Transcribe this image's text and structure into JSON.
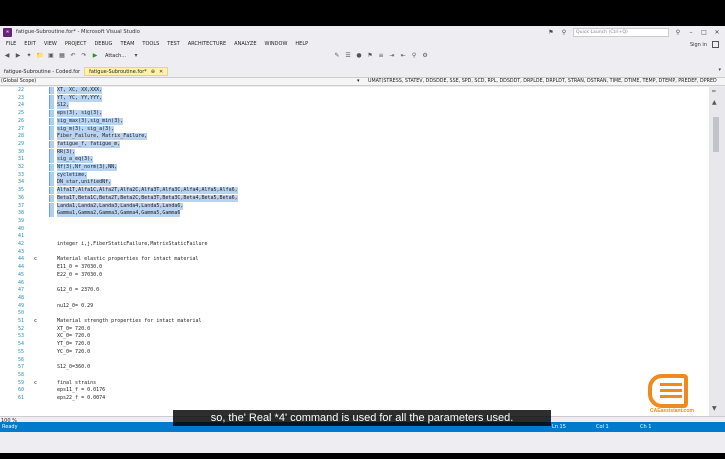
{
  "window": {
    "title": "fatigue-Subroutine.for* - Microsoft Visual Studio",
    "quick_launch_placeholder": "Quick Launch (Ctrl+Q)",
    "signin": "Sign in"
  },
  "menu": [
    "FILE",
    "EDIT",
    "VIEW",
    "PROJECT",
    "DEBUG",
    "TEAM",
    "TOOLS",
    "TEST",
    "ARCHITECTURE",
    "ANALYZE",
    "WINDOW",
    "HELP"
  ],
  "toolbar": {
    "attach_label": "Attach..."
  },
  "tabs": [
    {
      "label": "fatigue-Subroutine - Coded.for",
      "active": false
    },
    {
      "label": "fatigue-Subroutine.for*",
      "active": true
    }
  ],
  "navbar": {
    "scope": "(Global Scope)",
    "member": "UMAT(STRESS, STATEV, DDSDDE, SSE, SPD, SCD, RPL, DDSDDT, DRPLDE, DRPLDT, STRAN, DSTRAN, TIME, DTIME, TEMP, DTEMP, PREDEF, DPRED"
  },
  "code_lines": [
    {
      "num": "22",
      "mark": "",
      "text": "XT, XC, XX,XXX,",
      "selected": true
    },
    {
      "num": "23",
      "mark": "",
      "text": "YT, YC, YY,YYY,",
      "selected": true
    },
    {
      "num": "24",
      "mark": "",
      "text": "S12,",
      "selected": true
    },
    {
      "num": "25",
      "mark": "",
      "text": "eps(3), sig(3),",
      "selected": true
    },
    {
      "num": "26",
      "mark": "",
      "text": "sig_max(3),sig_min(3),",
      "selected": true
    },
    {
      "num": "27",
      "mark": "",
      "text": "sig_m(3), sig_a(3),",
      "selected": true
    },
    {
      "num": "28",
      "mark": "",
      "text": "Fiber_Failure, Matrix_Failure,",
      "selected": true
    },
    {
      "num": "29",
      "mark": "",
      "text": "fatigue_f, fatigue_m,",
      "selected": true
    },
    {
      "num": "30",
      "mark": "",
      "text": "RR(3),",
      "selected": true
    },
    {
      "num": "31",
      "mark": "",
      "text": "sig_a_eq(3),",
      "selected": true
    },
    {
      "num": "32",
      "mark": "",
      "text": "Nf(3),Nf_norm(3),NN,",
      "selected": true
    },
    {
      "num": "33",
      "mark": "",
      "text": "cycletime,",
      "selected": true
    },
    {
      "num": "34",
      "mark": "",
      "text": "DN_star,unifiedNf,",
      "selected": true
    },
    {
      "num": "35",
      "mark": "",
      "text": "Alfa1T,Alfa1C,Alfa2T,Alfa2C,Alfa3T,Alfa3C,Alfa4,Alfa5,Alfa6,",
      "selected": true
    },
    {
      "num": "36",
      "mark": "",
      "text": "Beta1T,Beta1C,Beta2T,Beta2C,Beta3T,Beta3C,Beta4,Beta5,Beta6,",
      "selected": true
    },
    {
      "num": "37",
      "mark": "",
      "text": "Landa1,Landa2,Landa3,Landa4,Landa5,Landa6,",
      "selected": true
    },
    {
      "num": "38",
      "mark": "",
      "text": "Gamma1,Gamma2,Gamma3,Gamma4,Gamma5,Gamma6",
      "selected": true
    },
    {
      "num": "39",
      "mark": "",
      "text": "",
      "selected": false
    },
    {
      "num": "40",
      "mark": "",
      "text": "",
      "selected": false
    },
    {
      "num": "41",
      "mark": "",
      "text": "",
      "selected": false
    },
    {
      "num": "42",
      "mark": "",
      "text": "integer i,j,FiberStaticFailure,MatrixStaticFailure",
      "selected": false
    },
    {
      "num": "43",
      "mark": "",
      "text": "",
      "selected": false
    },
    {
      "num": "44",
      "mark": "c",
      "text": "Material elastic properties for intact material",
      "selected": false
    },
    {
      "num": "44",
      "mark": "",
      "text": "E11_0 = 37030.0",
      "selected": false
    },
    {
      "num": "45",
      "mark": "",
      "text": "E22_0 = 37030.0",
      "selected": false
    },
    {
      "num": "46",
      "mark": "",
      "text": "",
      "selected": false
    },
    {
      "num": "47",
      "mark": "",
      "text": "G12_0 = 2370.0",
      "selected": false
    },
    {
      "num": "48",
      "mark": "",
      "text": "",
      "selected": false
    },
    {
      "num": "49",
      "mark": "",
      "text": "nu12_0= 0.29",
      "selected": false
    },
    {
      "num": "50",
      "mark": "",
      "text": "",
      "selected": false
    },
    {
      "num": "51",
      "mark": "c",
      "text": "Material strength properties for intact material",
      "selected": false
    },
    {
      "num": "52",
      "mark": "",
      "text": "XT_0= 720.0",
      "selected": false
    },
    {
      "num": "53",
      "mark": "",
      "text": "XC_0= 720.0",
      "selected": false
    },
    {
      "num": "54",
      "mark": "",
      "text": "YT_0= 720.0",
      "selected": false
    },
    {
      "num": "55",
      "mark": "",
      "text": "YC_0= 720.0",
      "selected": false
    },
    {
      "num": "56",
      "mark": "",
      "text": "",
      "selected": false
    },
    {
      "num": "57",
      "mark": "",
      "text": "S12_0=360.0",
      "selected": false
    },
    {
      "num": "58",
      "mark": "",
      "text": "",
      "selected": false
    },
    {
      "num": "59",
      "mark": "c",
      "text": "final strains",
      "selected": false
    },
    {
      "num": "60",
      "mark": "",
      "text": "eps11_f = 0.0176",
      "selected": false
    },
    {
      "num": "61",
      "mark": "",
      "text": "eps22_f = 0.0074",
      "selected": false
    }
  ],
  "zoom": "100 %",
  "status": {
    "ready": "Ready",
    "ln": "Ln 15",
    "col": "Col 1",
    "ch": "Ch 1"
  },
  "subtitle": "so, the' Real *4' command is used for all the parameters used.",
  "watermark": {
    "text": "CAEassistant.com"
  },
  "colors": {
    "accent": "#007acc",
    "selection": "#b8d4f2",
    "logo": "#f08a1c",
    "active_tab": "#fff2a8"
  }
}
